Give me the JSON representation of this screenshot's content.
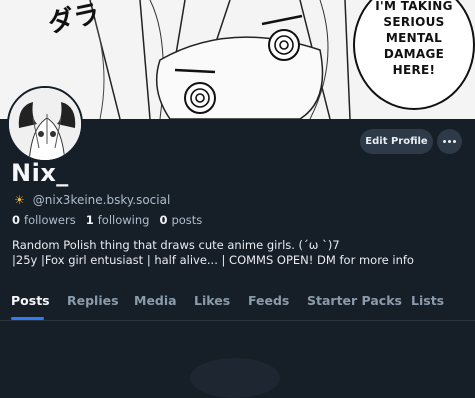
{
  "banner": {
    "sfx_text": "ダラ",
    "speech_lines": [
      "I'M TAKING",
      "SERIOUS",
      "MENTAL",
      "DAMAGE",
      "HERE!"
    ]
  },
  "profile": {
    "display_name": "Nix_",
    "handle": "@nix3keine.bsky.social",
    "handle_icon": "☀",
    "edit_label": "Edit Profile",
    "more_label": "more-options",
    "stats": {
      "followers_count": "0",
      "followers_label": "followers",
      "following_count": "1",
      "following_label": "following",
      "posts_count": "0",
      "posts_label": "posts"
    },
    "bio_line1": "Random Polish thing that draws cute anime girls. (´ω `)7",
    "bio_line2": "|25y |Fox girl entusiast | half alive... | COMMS OPEN! DM for more info"
  },
  "tabs": [
    {
      "label": "Posts",
      "active": true
    },
    {
      "label": "Replies"
    },
    {
      "label": "Media"
    },
    {
      "label": "Likes"
    },
    {
      "label": "Feeds"
    },
    {
      "label": "Starter Packs"
    },
    {
      "label": "Lists"
    }
  ],
  "colors": {
    "background": "#161e27",
    "accent": "#2f7bf5",
    "button_bg": "#2e3a47"
  }
}
